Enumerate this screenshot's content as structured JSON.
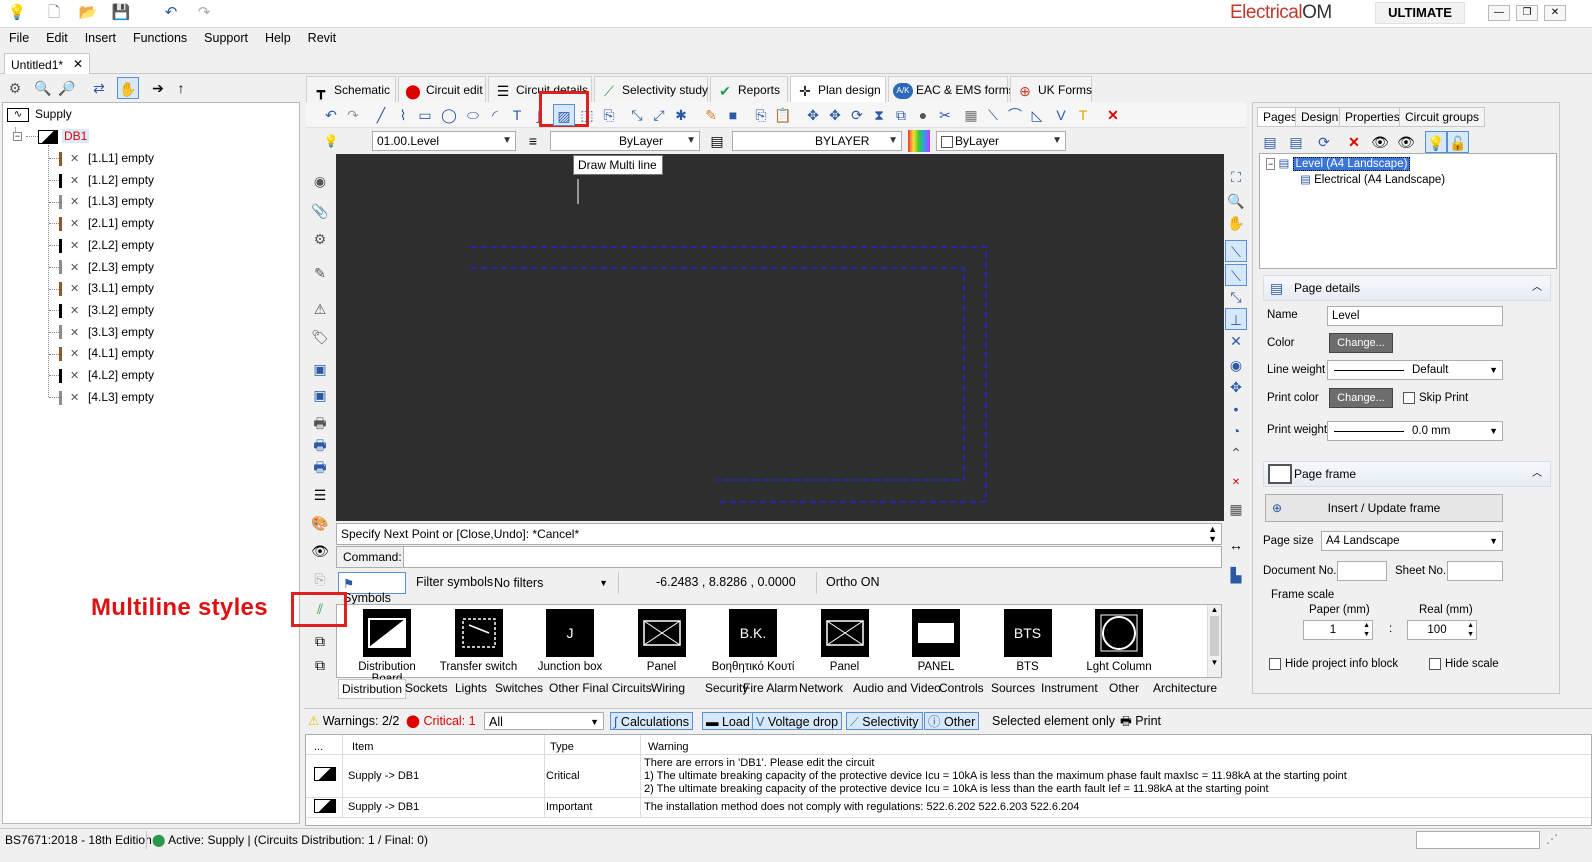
{
  "brand": {
    "name_red": "Electrical",
    "name_dark": "OM",
    "edition": "ULTIMATE"
  },
  "menu": [
    "File",
    "Edit",
    "Insert",
    "Functions",
    "Support",
    "Help",
    "Revit"
  ],
  "document_tab": {
    "label": "Untitled1*",
    "close": "✕"
  },
  "tree": {
    "root": "Supply",
    "board": "DB1",
    "items": [
      {
        "label": "[1.L1] empty",
        "color": "#8b5a2b"
      },
      {
        "label": "[1.L2] empty",
        "color": "#000000"
      },
      {
        "label": "[1.L3] empty",
        "color": "#8c8c8c"
      },
      {
        "label": "[2.L1] empty",
        "color": "#8b5a2b"
      },
      {
        "label": "[2.L2] empty",
        "color": "#000000"
      },
      {
        "label": "[2.L3] empty",
        "color": "#8c8c8c"
      },
      {
        "label": "[3.L1] empty",
        "color": "#8b5a2b"
      },
      {
        "label": "[3.L2] empty",
        "color": "#000000"
      },
      {
        "label": "[3.L3] empty",
        "color": "#8c8c8c"
      },
      {
        "label": "[4.L1] empty",
        "color": "#8b5a2b"
      },
      {
        "label": "[4.L2] empty",
        "color": "#000000"
      },
      {
        "label": "[4.L3] empty",
        "color": "#8c8c8c"
      }
    ]
  },
  "main_tabs": [
    "Schematic",
    "Circuit edit",
    "Circuit details",
    "Selectivity study",
    "Reports",
    "Plan design",
    "EAC & EMS forms",
    "UK Forms"
  ],
  "prop_bar": {
    "layer": "01.00.Level",
    "linetype": "ByLayer",
    "lineweight": "BYLAYER",
    "color": "ByLayer"
  },
  "tooltip": "Draw Multi line",
  "command": {
    "prompt": "Specify Next Point or [Close,Undo]: *Cancel*",
    "label": "Command:",
    "value": ""
  },
  "symbols_bar": {
    "button": "Symbols",
    "filter_label": "Filter symbols",
    "filter_value": "No filters",
    "coords": "-6.2483 , 8.8286 , 0.0000",
    "ortho": "Ortho ON"
  },
  "symbols": [
    {
      "label": "Distribution Board",
      "glyph": ""
    },
    {
      "label": "Transfer switch",
      "glyph": ""
    },
    {
      "label": "Junction box",
      "glyph": "J"
    },
    {
      "label": "Panel",
      "glyph": ""
    },
    {
      "label": "Βοηθητικό Κουτί",
      "glyph": "B.K."
    },
    {
      "label": "Panel",
      "glyph": ""
    },
    {
      "label": "PANEL",
      "glyph": ""
    },
    {
      "label": "BTS",
      "glyph": "BTS"
    },
    {
      "label": "Lght Column",
      "glyph": ""
    }
  ],
  "categories": [
    "Distribution",
    "Sockets",
    "Lights",
    "Switches",
    "Other Final Circuits",
    "Wiring",
    "Security",
    "Fire Alarm",
    "Network",
    "Audio and Video",
    "Controls",
    "Sources",
    "Instrument",
    "Other",
    "Architecture"
  ],
  "annotation": "Multiline styles",
  "warnings_bar": {
    "warnings": "Warnings: 2/2",
    "critical": "Critical: 1",
    "filter": "All",
    "calculations": "Calculations",
    "load": "Load",
    "voltage_drop": "Voltage drop",
    "selectivity": "Selectivity",
    "other": "Other",
    "selected_only": "Selected element only",
    "print": "Print"
  },
  "grid": {
    "headers": [
      "...",
      "Item",
      "Type",
      "Warning"
    ],
    "rows": [
      {
        "item": "Supply -> DB1",
        "type": "Critical",
        "lines": [
          "There are errors in 'DB1'. Please edit the circuit",
          "1) The ultimate breaking capacity of the protective device Icu = 10kA is less than the maximum phase fault maxIsc = 11.98kA at the starting point",
          "2) The ultimate breaking capacity of the protective device Icu = 10kA is less than the earth fault Ief = 11.98kA at the starting point"
        ]
      },
      {
        "item": "Supply -> DB1",
        "type": "Important",
        "lines": [
          "The installation method does not comply with regulations: 522.6.202 522.6.203 522.6.204"
        ]
      }
    ]
  },
  "right_panel": {
    "tabs": [
      "Pages",
      "Design",
      "Properties",
      "Circuit groups"
    ],
    "page_tree": {
      "level": "Level (A4 Landscape)",
      "child": "Electrical (A4 Landscape)"
    },
    "page_details": {
      "title": "Page details",
      "name_label": "Name",
      "name_value": "Level",
      "color_label": "Color",
      "change": "Change...",
      "line_weight_label": "Line weight",
      "line_weight_value": "Default",
      "print_color_label": "Print color",
      "skip_print": "Skip Print",
      "print_weight_label": "Print weight",
      "print_weight_value": "0.0 mm"
    },
    "page_frame": {
      "title": "Page frame",
      "insert_button": "Insert / Update frame",
      "page_size_label": "Page size",
      "page_size_value": "A4 Landscape",
      "doc_no_label": "Document No.",
      "sheet_no_label": "Sheet No.",
      "frame_scale_label": "Frame scale",
      "paper_label": "Paper (mm)",
      "real_label": "Real (mm)",
      "paper_value": "1",
      "colon": ":",
      "real_value": "100",
      "hide_info": "Hide project info block",
      "hide_scale": "Hide scale"
    }
  },
  "status": {
    "standard": "BS7671:2018 - 18th Edition",
    "active": "Active: Supply | (Circuits Distribution: 1 / Final: 0)"
  }
}
